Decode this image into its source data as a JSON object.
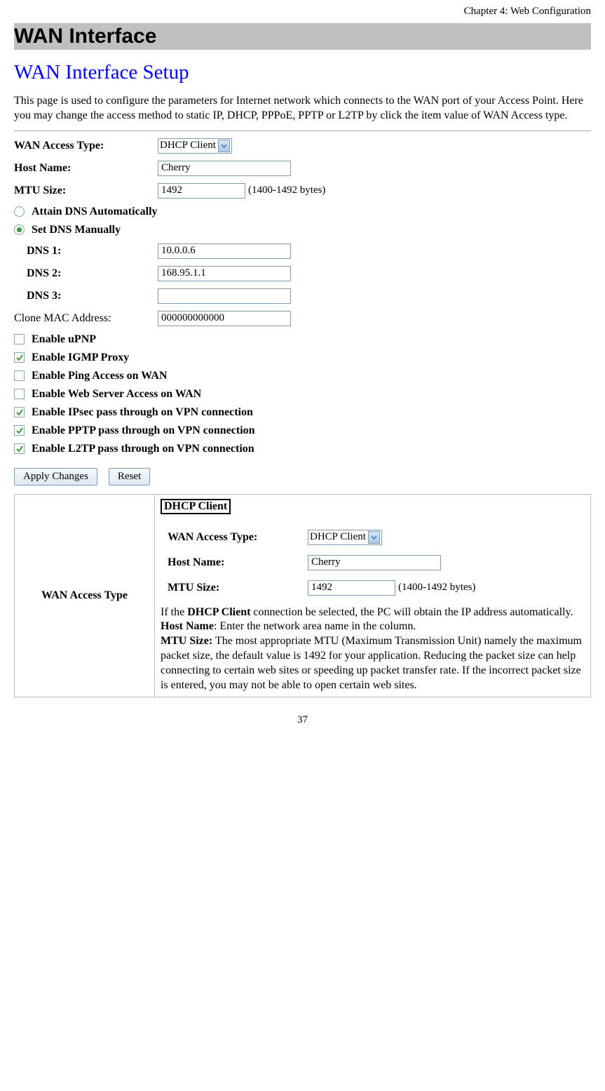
{
  "header": {
    "chapter": "Chapter 4: Web Configuration"
  },
  "section": {
    "title": "WAN Interface"
  },
  "setup": {
    "heading": "WAN Interface Setup",
    "description": "This page is used to configure the parameters for Internet network which connects to the WAN port of your Access Point. Here you may change the access method to static IP, DHCP, PPPoE, PPTP or L2TP by click the item value of WAN Access type."
  },
  "form": {
    "wan_access_type_label": "WAN Access Type:",
    "wan_access_type_value": "DHCP Client",
    "host_name_label": "Host Name:",
    "host_name_value": "Cherry",
    "mtu_label": "MTU Size:",
    "mtu_value": "1492",
    "mtu_hint": "(1400-1492 bytes)",
    "dns_auto_label": "Attain DNS Automatically",
    "dns_manual_label": "Set DNS Manually",
    "dns1_label": "DNS 1:",
    "dns1_value": "10.0.0.6",
    "dns2_label": "DNS 2:",
    "dns2_value": "168.95.1.1",
    "dns3_label": "DNS 3:",
    "dns3_value": "",
    "clone_mac_label": "Clone MAC Address:",
    "clone_mac_value": "000000000000",
    "chk_upnp": "Enable uPNP",
    "chk_igmp": "Enable IGMP Proxy",
    "chk_ping": "Enable Ping Access on WAN",
    "chk_web": "Enable Web Server Access on WAN",
    "chk_ipsec": "Enable IPsec pass through on VPN connection",
    "chk_pptp": "Enable PPTP pass through on VPN connection",
    "chk_l2tp": "Enable L2TP pass through on VPN connection",
    "btn_apply": "Apply Changes",
    "btn_reset": "Reset"
  },
  "table": {
    "row_label": "WAN Access Type",
    "dhcp_heading": "DHCP Client",
    "inner_wan_label": "WAN Access Type:",
    "inner_wan_value": "DHCP Client",
    "inner_host_label": "Host Name:",
    "inner_host_value": "Cherry",
    "inner_mtu_label": "MTU Size:",
    "inner_mtu_value": "1492",
    "inner_mtu_hint": "(1400-1492 bytes)",
    "desc_line1a": "If the ",
    "desc_line1b": "DHCP Client",
    "desc_line1c": " connection be selected, the PC will obtain the IP address automatically.",
    "desc_hostname_label": "Host Name",
    "desc_hostname_text": ": Enter the network area name in the column.",
    "desc_mtu_label": "MTU Size:",
    "desc_mtu_text": " The most appropriate MTU (Maximum Transmission Unit) namely the maximum packet size, the default value is 1492 for your application. Reducing the packet size can help connecting to certain web sites or speeding up packet transfer rate. If the incorrect packet size is entered, you may not be able to open certain web sites."
  },
  "footer": {
    "page_number": "37"
  }
}
